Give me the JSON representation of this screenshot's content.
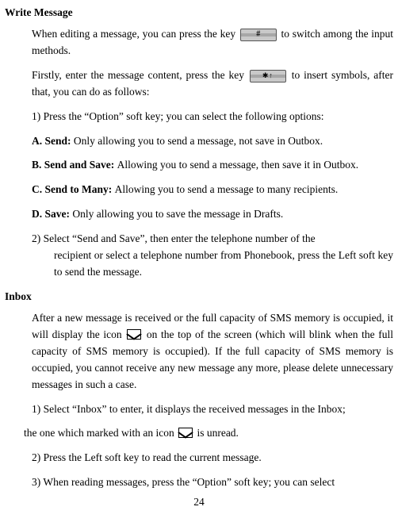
{
  "headings": {
    "write_message": "Write Message",
    "inbox": "Inbox"
  },
  "write": {
    "p1a": "When editing a message, you can press the key ",
    "p1b": " to switch among the input methods.",
    "p2a": "Firstly, enter the message content, press the key ",
    "p2b": " to insert symbols, after that, you can do as follows:",
    "step1": "1) Press the “Option” soft key; you can select the following options:",
    "a_label": "A. Send: ",
    "a_text": "Only allowing you to send a message, not save in Outbox.",
    "b_label": "B. Send and Save: ",
    "b_text": "Allowing you to send a message, then save it in Outbox.",
    "c_label": "C. Send to Many: ",
    "c_text": "Allowing you to send a message to many recipients.",
    "d_label": "D. Save: ",
    "d_text": "Only allowing you to save the message in Drafts.",
    "step2_first": "2)  Select “Send and Save”, then enter the telephone number of the",
    "step2_rest": "recipient or select a telephone number from Phonebook, press the Left soft key to send the message."
  },
  "inbox": {
    "p1a": "After a new message is received or the full capacity of SMS memory is occupied, it will display the icon ",
    "p1b": " on the top of the screen (which will blink when the full capacity of SMS memory is occupied). If the full capacity of SMS memory is occupied, you cannot receive any new message any more, please delete unnecessary messages in such a case.",
    "s1": "1) Select “Inbox” to enter, it displays the received messages in the Inbox;",
    "unread_a": "the one which marked with an icon ",
    "unread_b": " is unread.",
    "s2": "2) Press the Left soft key to read the current message.",
    "s3": "3) When reading messages, press the “Option” soft key; you can select"
  },
  "page_number": "24"
}
